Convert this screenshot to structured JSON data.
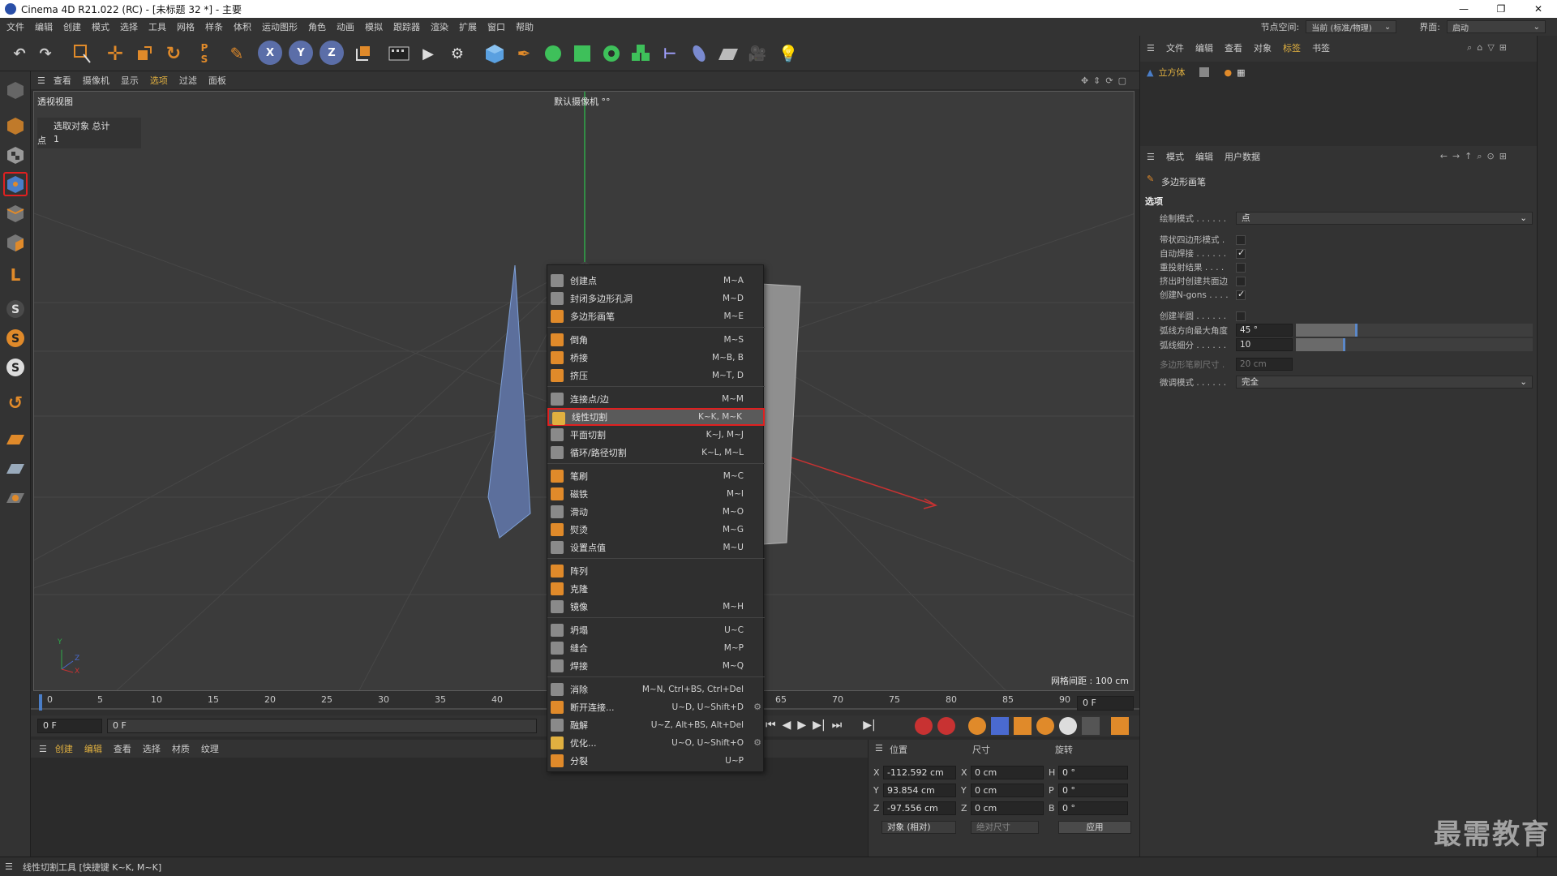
{
  "window": {
    "title": "Cinema 4D R21.022 (RC) - [未标题 32 *] - 主要",
    "controls": [
      "—",
      "❐",
      "✕"
    ]
  },
  "menubar": {
    "items": [
      "文件",
      "编辑",
      "创建",
      "模式",
      "选择",
      "工具",
      "网格",
      "样条",
      "体积",
      "运动图形",
      "角色",
      "动画",
      "模拟",
      "跟踪器",
      "渲染",
      "扩展",
      "窗口",
      "帮助"
    ],
    "node_space_label": "节点空间:",
    "node_space_value": "当前 (标准/物理)",
    "layout_label": "界面:",
    "layout_value": "启动"
  },
  "viewport": {
    "menu": [
      "查看",
      "摄像机",
      "显示",
      "选项",
      "过滤",
      "面板"
    ],
    "view_name": "透视视图",
    "camera_label": "默认摄像机 °°",
    "hud_header": "选取对象 总计",
    "hud_row_label": "点",
    "hud_row_value": "1",
    "grid_spacing": "网格间距 : 100 cm",
    "axis_y": "Y",
    "axis_z": "Z",
    "axis_x": "X"
  },
  "context_menu": {
    "items": [
      {
        "label": "创建点",
        "shortcut": "M~A",
        "icon_color": "#8a8a8a"
      },
      {
        "label": "封闭多边形孔洞",
        "shortcut": "M~D",
        "icon_color": "#8a8a8a"
      },
      {
        "label": "多边形画笔",
        "shortcut": "M~E",
        "icon_color": "#e08a2a"
      },
      {
        "label": "倒角",
        "shortcut": "M~S",
        "icon_color": "#e08a2a"
      },
      {
        "label": "桥接",
        "shortcut": "M~B, B",
        "icon_color": "#e08a2a"
      },
      {
        "label": "挤压",
        "shortcut": "M~T, D",
        "icon_color": "#e08a2a"
      },
      {
        "label": "连接点/边",
        "shortcut": "M~M",
        "icon_color": "#8a8a8a"
      },
      {
        "label": "线性切割",
        "shortcut": "K~K, M~K",
        "icon_color": "#e0b040"
      },
      {
        "label": "平面切割",
        "shortcut": "K~J, M~J",
        "icon_color": "#8a8a8a"
      },
      {
        "label": "循环/路径切割",
        "shortcut": "K~L, M~L",
        "icon_color": "#8a8a8a"
      },
      {
        "label": "笔刷",
        "shortcut": "M~C",
        "icon_color": "#e08a2a"
      },
      {
        "label": "磁铁",
        "shortcut": "M~I",
        "icon_color": "#e08a2a"
      },
      {
        "label": "滑动",
        "shortcut": "M~O",
        "icon_color": "#8a8a8a"
      },
      {
        "label": "熨烫",
        "shortcut": "M~G",
        "icon_color": "#e08a2a"
      },
      {
        "label": "设置点值",
        "shortcut": "M~U",
        "icon_color": "#8a8a8a"
      },
      {
        "label": "阵列",
        "shortcut": "",
        "icon_color": "#e08a2a"
      },
      {
        "label": "克隆",
        "shortcut": "",
        "icon_color": "#e08a2a"
      },
      {
        "label": "镜像",
        "shortcut": "M~H",
        "icon_color": "#8a8a8a"
      },
      {
        "label": "坍塌",
        "shortcut": "U~C",
        "icon_color": "#8a8a8a"
      },
      {
        "label": "缝合",
        "shortcut": "M~P",
        "icon_color": "#8a8a8a"
      },
      {
        "label": "焊接",
        "shortcut": "M~Q",
        "icon_color": "#8a8a8a"
      },
      {
        "label": "消除",
        "shortcut": "M~N, Ctrl+BS, Ctrl+Del",
        "icon_color": "#8a8a8a"
      },
      {
        "label": "断开连接...",
        "shortcut": "U~D, U~Shift+D",
        "icon_color": "#e08a2a"
      },
      {
        "label": "融解",
        "shortcut": "U~Z, Alt+BS, Alt+Del",
        "icon_color": "#8a8a8a"
      },
      {
        "label": "优化...",
        "shortcut": "U~O, U~Shift+O",
        "icon_color": "#e0b040"
      },
      {
        "label": "分裂",
        "shortcut": "U~P",
        "icon_color": "#e08a2a"
      }
    ]
  },
  "timeline": {
    "ticks": [
      "0",
      "5",
      "10",
      "15",
      "20",
      "25",
      "30",
      "35",
      "40",
      "65",
      "70",
      "75",
      "80",
      "85",
      "90"
    ],
    "current_frame_field": "0 F",
    "start_field": "0 F",
    "range_field": "0 F"
  },
  "material_manager": {
    "menu": [
      "创建",
      "编辑",
      "查看",
      "选择",
      "材质",
      "纹理"
    ]
  },
  "coordinates": {
    "headers": [
      "位置",
      "尺寸",
      "旋转"
    ],
    "rows": [
      {
        "axis": "X",
        "pos": "-112.592 cm",
        "size_axis": "X",
        "size": "0 cm",
        "rot_axis": "H",
        "rot": "0 °"
      },
      {
        "axis": "Y",
        "pos": "93.854 cm",
        "size_axis": "Y",
        "size": "0 cm",
        "rot_axis": "P",
        "rot": "0 °"
      },
      {
        "axis": "Z",
        "pos": "-97.556 cm",
        "size_axis": "Z",
        "size": "0 cm",
        "rot_axis": "B",
        "rot": "0 °"
      }
    ],
    "mode_dropdown": "对象 (相对)",
    "size_dropdown": "绝对尺寸",
    "apply_button": "应用"
  },
  "object_manager": {
    "menu": [
      "文件",
      "编辑",
      "查看",
      "对象",
      "标签",
      "书签"
    ],
    "object_name": "立方体"
  },
  "attribute_manager": {
    "menu": [
      "模式",
      "编辑",
      "用户数据"
    ],
    "tool_name": "多边形画笔",
    "section": "选项",
    "draw_mode_label": "绘制模式 . . . . . .",
    "draw_mode_value": "点",
    "checkboxes": [
      {
        "label": "带状四边形模式 .",
        "checked": false
      },
      {
        "label": "自动焊接 . . . . . .",
        "checked": true
      },
      {
        "label": "重投射结果 . . . .",
        "checked": false
      },
      {
        "label": "挤出时创建共面边",
        "checked": false
      },
      {
        "label": "创建N-gons . . . .",
        "checked": true
      }
    ],
    "create_semicircle_label": "创建半圆 . . . . . .",
    "create_semicircle_checked": false,
    "arc_angle_label": "弧线方向最大角度",
    "arc_angle_value": "45 °",
    "arc_angle_fraction": 0.25,
    "arc_subdiv_label": "弧线细分 . . . . . .",
    "arc_subdiv_value": "10",
    "arc_subdiv_fraction": 0.2,
    "brush_size_label": "多边形笔刷尺寸 .",
    "brush_size_value": "20 cm",
    "tweak_mode_label": "微调模式 . . . . . .",
    "tweak_mode_value": "完全"
  },
  "statusbar": {
    "text": "线性切割工具 [快捷键 K~K, M~K]"
  },
  "watermark": "最需教育",
  "colors": {
    "accent_red": "#e02020",
    "selection_blue": "#4a7ec8",
    "orange": "#e08a2a"
  }
}
